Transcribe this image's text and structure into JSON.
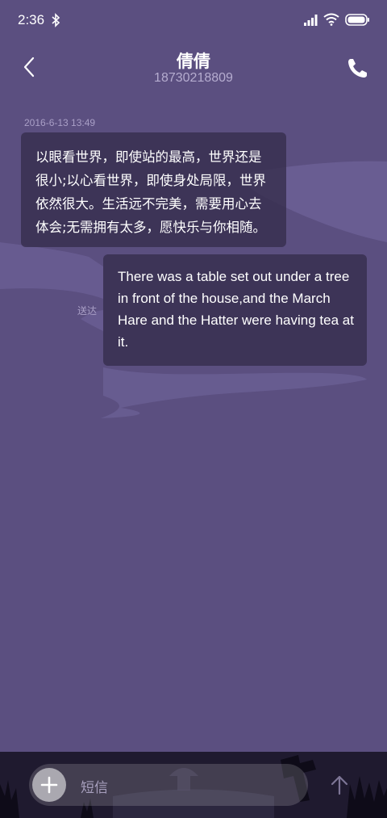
{
  "status_bar": {
    "time": "2:36",
    "icons": [
      "bluetooth-icon",
      "signal-icon",
      "wifi-icon",
      "battery-icon"
    ]
  },
  "header": {
    "contact_name": "倩倩",
    "contact_number": "18730218809",
    "back_icon": "chevron-left-icon",
    "call_icon": "phone-icon"
  },
  "conversation": {
    "timestamp": "2016-6-13 13:49",
    "messages": [
      {
        "direction": "incoming",
        "text": "以眼看世界，即使站的最高，世界还是很小;以心看世界，即使身处局限，世界依然很大。生活远不完美，需要用心去体会;无需拥有太多，愿快乐与你相随。"
      },
      {
        "direction": "outgoing",
        "text": "There was a table set out under a tree in front of the house,and the March Hare and the Hatter were having tea at it.",
        "status": "送达"
      }
    ]
  },
  "composer": {
    "placeholder": "短信",
    "add_icon": "plus-icon",
    "send_icon": "arrow-up-icon"
  },
  "colors": {
    "background": "#5b4f80",
    "bubble": "#372e4e",
    "bottom_bar": "#1f1a2f",
    "muted_text": "#a99fc6"
  }
}
